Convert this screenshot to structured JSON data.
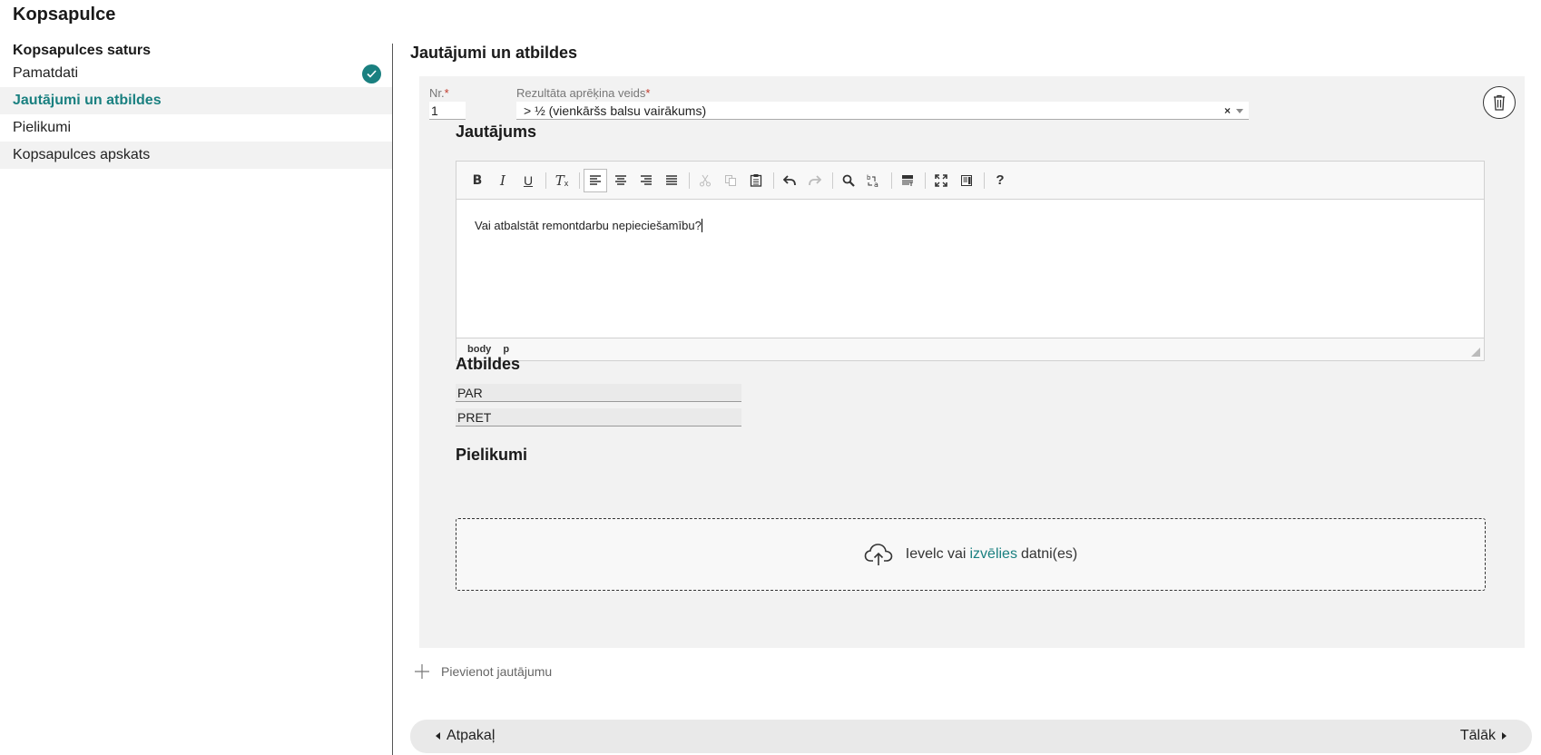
{
  "app": {
    "title": "Kopsapulce"
  },
  "sidebar": {
    "heading": "Kopsapulces saturs",
    "items": [
      {
        "label": "Pamatdati",
        "completed": true
      },
      {
        "label": "Jautājumi un atbildes",
        "active": true
      },
      {
        "label": "Pielikumi"
      },
      {
        "label": "Kopsapulces apskats"
      }
    ]
  },
  "main": {
    "title": "Jautājumi un atbildes",
    "question": {
      "nr_label": "Nr.",
      "required_mark": "*",
      "nr_value": "1",
      "calc_label": "Rezultāta aprēķina veids",
      "calc_value": "> ½ (vienkāršs balsu vairākums)",
      "clear_symbol": "×",
      "question_title": "Jautājums",
      "editor_text": "Vai atbalstāt remontdarbu nepieciešamību?",
      "editor_path": [
        "body",
        "p"
      ],
      "answers_title": "Atbildes",
      "answers": [
        "PAR",
        "PRET"
      ],
      "attachments_title": "Pielikumi",
      "dropzone": {
        "before": "Ievelc vai",
        "link": "izvēlies",
        "after": "datni(es)"
      }
    },
    "add_question_label": "Pievienot jautājumu"
  },
  "footer": {
    "back_label": "Atpakaļ",
    "next_label": "Tālāk"
  },
  "colors": {
    "accent": "#1a8080",
    "card_bg": "#f2f2f2",
    "required": "#c0392b"
  }
}
